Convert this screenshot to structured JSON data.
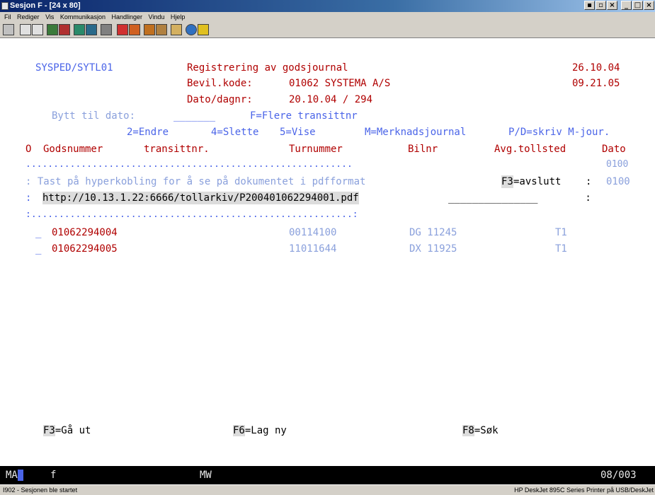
{
  "window": {
    "title": "Sesjon F - [24 x 80]"
  },
  "menu": [
    "Fil",
    "Rediger",
    "Vis",
    "Kommunikasjon",
    "Handlinger",
    "Vindu",
    "Hjelp"
  ],
  "toolbar_icons": [
    "print-screen-icon",
    "copy-icon",
    "paste-icon",
    "send-icon",
    "receive-icon",
    "display-icon",
    "keypad-icon",
    "macro-icon",
    "record-macro-icon",
    "play-macro-icon",
    "stop-macro-icon",
    "macro-list-icon",
    "clipboard-icon",
    "globe-icon",
    "help-icon"
  ],
  "header": {
    "program": "SYSPED/SYTL01",
    "title": "Registrering av godsjournal",
    "date": "26.10.04",
    "bevil_label": "Bevil.kode:",
    "bevil_value": "01062 SYSTEMA A/S",
    "time": "09.21.05",
    "dato_label": "Dato/dagnr:",
    "dato_value": "20.10.04 / 294"
  },
  "bytt": {
    "label": "Bytt til dato:",
    "input": "_______",
    "flere": "F=Flere transittnr"
  },
  "options": {
    "endre": "2=Endre",
    "slette": "4=Slette",
    "vise": "5=Vise",
    "merknad": "M=Merknadsjournal",
    "skriv": "P/D=skriv M-jour."
  },
  "columns": {
    "o": "O",
    "godsnummer": "Godsnummer",
    "transittnr": "transittnr.",
    "turnummer": "Turnummer",
    "bilnr": "Bilnr",
    "avg": "Avg.tollsted",
    "dato": "Dato"
  },
  "popup": {
    "border_top": "...........................................................",
    "code1": "0100",
    "prompt": ": Tast på hyperkobling for å se på dokumentet i pdfformat",
    "f3_key": "F3",
    "f3_label": "=avslutt",
    "colon": ":",
    "code2": "0100",
    "url_prefix": ": ",
    "url": "http://10.13.1.22:6666/tollarkiv/P200401062294001.pdf",
    "url_fill": "_______________",
    "url_end": " :",
    "border_bottom": ":..........................................................:"
  },
  "rows": [
    {
      "sel": "_",
      "godsnummer": "01062294004",
      "turnummer": "00114100",
      "bilnr": "DG 11245",
      "avg": "T1"
    },
    {
      "sel": "_",
      "godsnummer": "01062294005",
      "turnummer": "11011644",
      "bilnr": "DX 11925",
      "avg": "T1"
    }
  ],
  "fkeys": {
    "f3": {
      "key": "F3",
      "label": "=Gå ut"
    },
    "f6": {
      "key": "F6",
      "label": "=Lag ny"
    },
    "f8": {
      "key": "F8",
      "label": "=Søk"
    }
  },
  "status": {
    "ma": "MA",
    "f": "f",
    "mw": "MW",
    "pos": "08/003"
  },
  "bottom": {
    "left": "I902 - Sesjonen ble startet",
    "right": "HP DeskJet 895C Series Printer på USB/DeskJet"
  }
}
